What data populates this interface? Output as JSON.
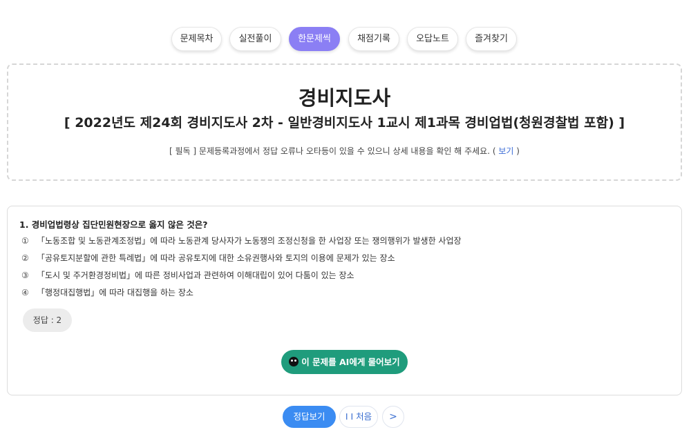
{
  "tabs": [
    {
      "label": "문제목차",
      "active": false
    },
    {
      "label": "실전풀이",
      "active": false
    },
    {
      "label": "한문제씩",
      "active": true
    },
    {
      "label": "채점기록",
      "active": false
    },
    {
      "label": "오답노트",
      "active": false
    },
    {
      "label": "즐겨찾기",
      "active": false
    }
  ],
  "header": {
    "title": "경비지도사",
    "subtitle": "[ 2022년도 제24회 경비지도사 2차 - 일반경비지도사 1교시 제1과목 경비업법(청원경찰법 포함) ]",
    "notice_prefix": "[ 필독 ] 문제등록과정에서 정답 오류나 오타등이 있을 수 있으니 상세 내용을 확인 해 주세요. (",
    "notice_link": "보기",
    "notice_suffix": ")"
  },
  "question": {
    "title": "1. 경비업법령상 집단민원현장으로 옳지 않은 것은?",
    "choices": [
      {
        "num": "①",
        "text": "「노동조합 및 노동관계조정법」에 따라 노동관계 당사자가 노동쟁의 조정신청을 한 사업장 또는 쟁의행위가 발생한 사업장"
      },
      {
        "num": "②",
        "text": "「공유토지분할에 관한 특례법」에 따라 공유토지에 대한 소유권행사와 토지의 이용에 문제가 있는 장소"
      },
      {
        "num": "③",
        "text": "「도시 및 주거환경정비법」에 따른 정비사업과 관련하여 이해대립이 있어 다툼이 있는 장소"
      },
      {
        "num": "④",
        "text": "「행정대집행법」에 따라 대집행을 하는 장소"
      }
    ],
    "answer_label": "정답 : 2",
    "ai_button_label": "이 문제를 AI에게 물어보기"
  },
  "bottom": {
    "answer_button": "정답보기",
    "first_button": "I I 처음",
    "next_button": ">"
  },
  "colors": {
    "active_tab": "#8b7ff4",
    "ai_button": "#1f9c7c",
    "answer_button": "#3b8cf2",
    "link": "#3a6bd6"
  }
}
